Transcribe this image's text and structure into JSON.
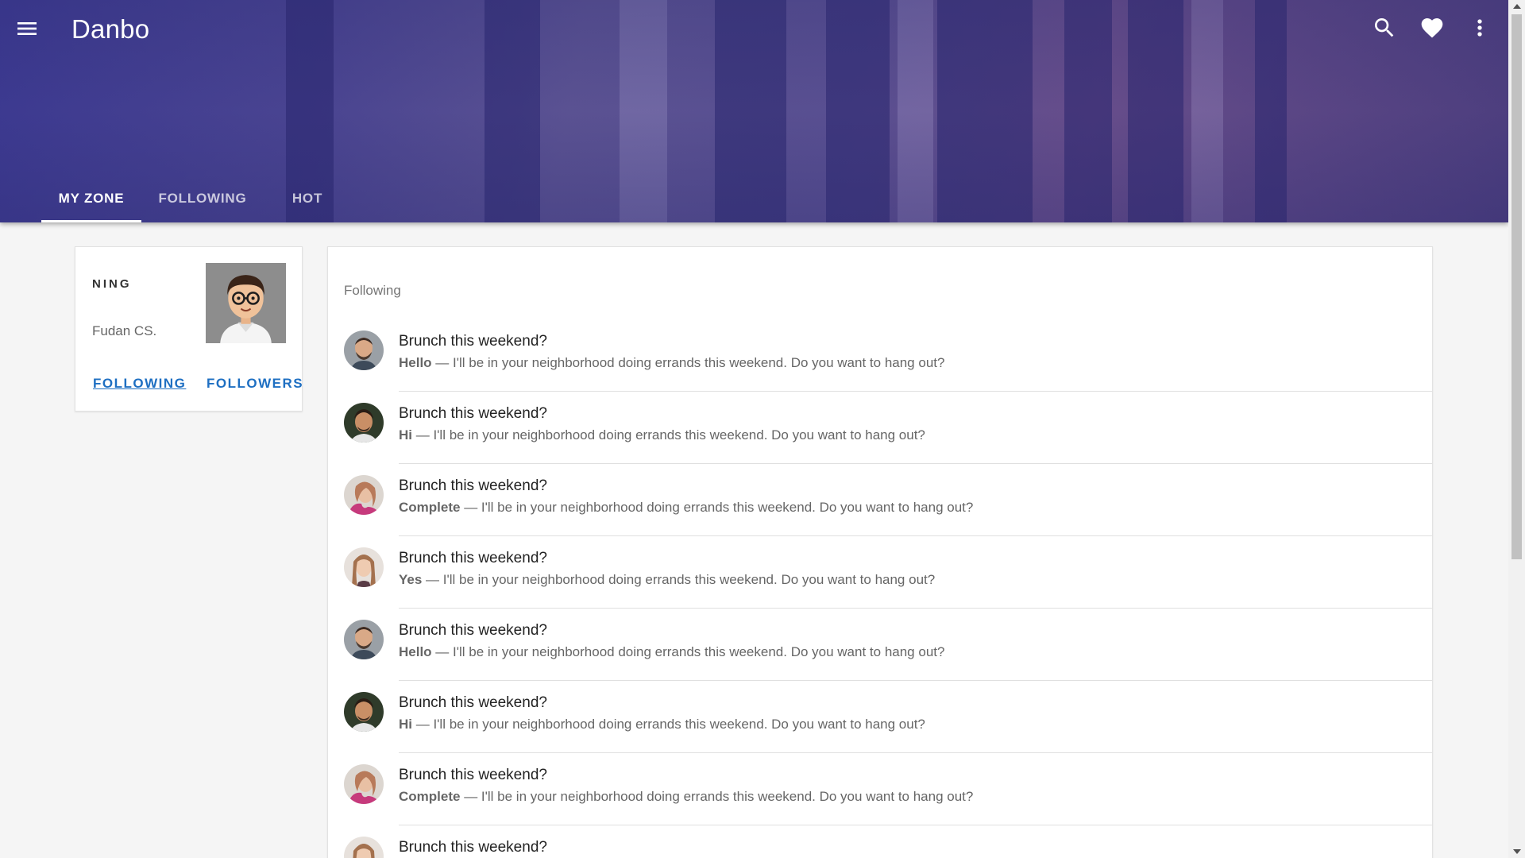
{
  "app": {
    "title": "Danbo"
  },
  "toolbar": {
    "menu_icon": "menu-icon",
    "search_icon": "search-icon",
    "favorite_icon": "heart-icon",
    "more_icon": "more-vert-icon"
  },
  "tabs": [
    {
      "label": "MY ZONE",
      "active": true
    },
    {
      "label": "FOLLOWING",
      "active": false
    },
    {
      "label": "HOT",
      "active": false
    }
  ],
  "profile": {
    "name": "NING",
    "subtitle": "Fudan CS.",
    "following_label": "FOLLOWING",
    "followers_label": "FOLLOWERS"
  },
  "feed": {
    "header": "Following",
    "items": [
      {
        "title": "Brunch this weekend?",
        "sender": "Hello",
        "text": " — I'll be in your neighborhood doing errands this weekend. Do you want to hang out?"
      },
      {
        "title": "Brunch this weekend?",
        "sender": "Hi",
        "text": " — I'll be in your neighborhood doing errands this weekend. Do you want to hang out?"
      },
      {
        "title": "Brunch this weekend?",
        "sender": "Complete",
        "text": " — I'll be in your neighborhood doing errands this weekend. Do you want to hang out?"
      },
      {
        "title": "Brunch this weekend?",
        "sender": "Yes",
        "text": " — I'll be in your neighborhood doing errands this weekend. Do you want to hang out?"
      },
      {
        "title": "Brunch this weekend?",
        "sender": "Hello",
        "text": " — I'll be in your neighborhood doing errands this weekend. Do you want to hang out?"
      },
      {
        "title": "Brunch this weekend?",
        "sender": "Hi",
        "text": " — I'll be in your neighborhood doing errands this weekend. Do you want to hang out?"
      },
      {
        "title": "Brunch this weekend?",
        "sender": "Complete",
        "text": " — I'll be in your neighborhood doing errands this weekend. Do you want to hang out?"
      },
      {
        "title": "Brunch this weekend?",
        "sender": "",
        "text": ""
      }
    ]
  },
  "colors": {
    "accent_link": "#1e6fc2",
    "banner": "#4c4693"
  }
}
